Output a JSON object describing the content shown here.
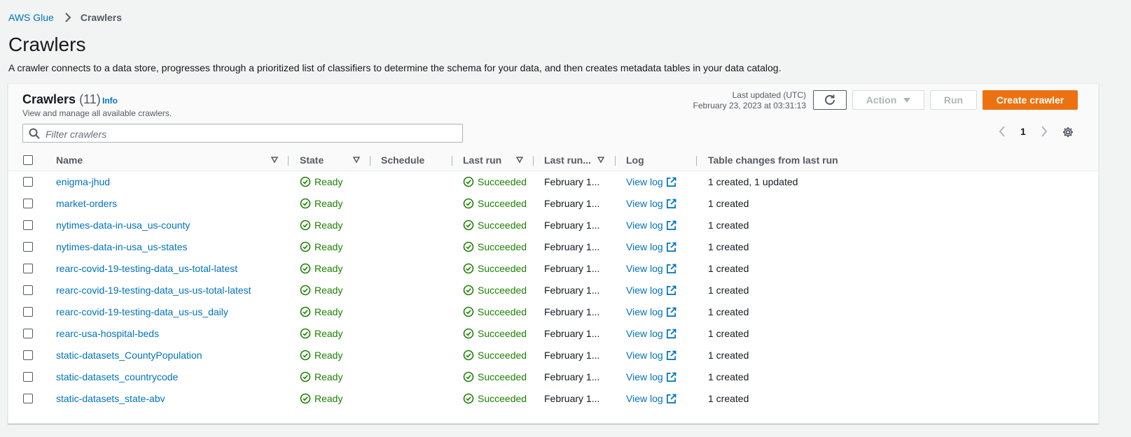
{
  "breadcrumb": {
    "root": "AWS Glue",
    "current": "Crawlers"
  },
  "page": {
    "title": "Crawlers",
    "description": "A crawler connects to a data store, progresses through a prioritized list of classifiers to determine the schema for your data, and then creates metadata tables in your data catalog."
  },
  "panel": {
    "title": "Crawlers",
    "count": "(11)",
    "info": "Info",
    "description": "View and manage all available crawlers.",
    "last_updated_label": "Last updated (UTC)",
    "last_updated_value": "February 23, 2023 at 03:31:13",
    "action_label": "Action",
    "run_label": "Run",
    "create_label": "Create crawler",
    "filter_placeholder": "Filter crawlers",
    "page_number": "1"
  },
  "colors": {
    "accent": "#ec7211",
    "link": "#0073bb",
    "success": "#1d8102"
  },
  "columns": {
    "name": "Name",
    "state": "State",
    "schedule": "Schedule",
    "last_run": "Last run",
    "last_run_time": "Last run...",
    "log": "Log",
    "table_changes": "Table changes from last run"
  },
  "rows": [
    {
      "name": "enigma-jhud",
      "state": "Ready",
      "last_run": "Succeeded",
      "last_run_time": "February 1...",
      "log": "View log",
      "table_changes": "1 created, 1 updated"
    },
    {
      "name": "market-orders",
      "state": "Ready",
      "last_run": "Succeeded",
      "last_run_time": "February 1...",
      "log": "View log",
      "table_changes": "1 created"
    },
    {
      "name": "nytimes-data-in-usa_us-county",
      "state": "Ready",
      "last_run": "Succeeded",
      "last_run_time": "February 1...",
      "log": "View log",
      "table_changes": "1 created"
    },
    {
      "name": "nytimes-data-in-usa_us-states",
      "state": "Ready",
      "last_run": "Succeeded",
      "last_run_time": "February 1...",
      "log": "View log",
      "table_changes": "1 created"
    },
    {
      "name": "rearc-covid-19-testing-data_us-total-latest",
      "state": "Ready",
      "last_run": "Succeeded",
      "last_run_time": "February 1...",
      "log": "View log",
      "table_changes": "1 created"
    },
    {
      "name": "rearc-covid-19-testing-data_us-us-total-latest",
      "state": "Ready",
      "last_run": "Succeeded",
      "last_run_time": "February 1...",
      "log": "View log",
      "table_changes": "1 created"
    },
    {
      "name": "rearc-covid-19-testing-data_us-us_daily",
      "state": "Ready",
      "last_run": "Succeeded",
      "last_run_time": "February 1...",
      "log": "View log",
      "table_changes": "1 created"
    },
    {
      "name": "rearc-usa-hospital-beds",
      "state": "Ready",
      "last_run": "Succeeded",
      "last_run_time": "February 1...",
      "log": "View log",
      "table_changes": "1 created"
    },
    {
      "name": "static-datasets_CountyPopulation",
      "state": "Ready",
      "last_run": "Succeeded",
      "last_run_time": "February 1...",
      "log": "View log",
      "table_changes": "1 created"
    },
    {
      "name": "static-datasets_countrycode",
      "state": "Ready",
      "last_run": "Succeeded",
      "last_run_time": "February 1...",
      "log": "View log",
      "table_changes": "1 created"
    },
    {
      "name": "static-datasets_state-abv",
      "state": "Ready",
      "last_run": "Succeeded",
      "last_run_time": "February 1...",
      "log": "View log",
      "table_changes": "1 created"
    }
  ]
}
